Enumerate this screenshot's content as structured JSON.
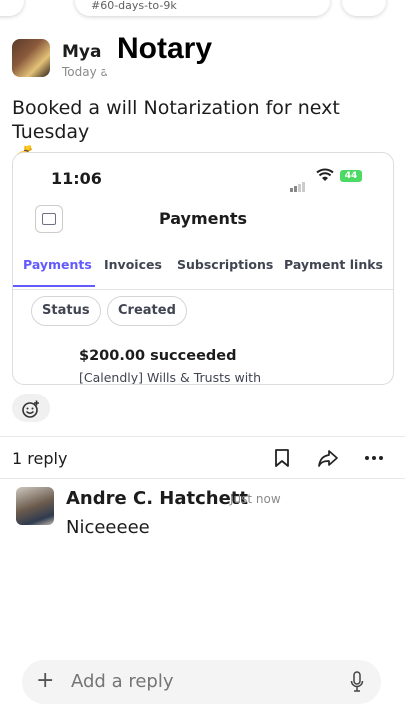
{
  "channel": {
    "name": "#60-days-to-9k"
  },
  "message": {
    "author": "Mya",
    "timestamp": "Today a",
    "overlay_title": "Notary",
    "text": "Booked a will Notarization for next Tuesday",
    "emoji": "💰"
  },
  "attachment": {
    "status_time": "11:06",
    "battery": "44",
    "title": "Payments",
    "tabs": [
      "Payments",
      "Invoices",
      "Subscriptions",
      "Payment links"
    ],
    "active_tab": "Payments",
    "filters": [
      "Status",
      "Created"
    ],
    "amount_line": "$200.00 succeeded",
    "description_line": "[Calendly] Wills & Trusts with"
  },
  "thread": {
    "reply_count": "1 reply",
    "reply": {
      "author": "Andre C. Hatchett",
      "time": "Just now",
      "text": "Niceeeee"
    }
  },
  "composer": {
    "placeholder": "Add a reply",
    "plus": "+"
  },
  "icons": {
    "emoji_add": "add-reaction-icon",
    "bookmark": "bookmark-icon",
    "share": "share-icon",
    "more": "more-icon",
    "mic": "microphone-icon"
  },
  "colors": {
    "accent": "#635bff",
    "battery": "#4cd964"
  }
}
